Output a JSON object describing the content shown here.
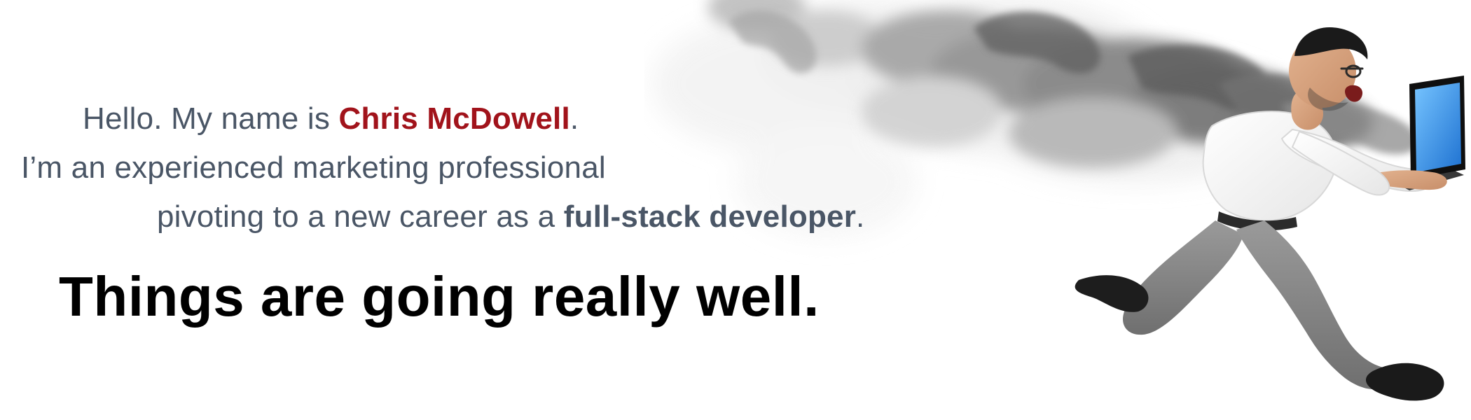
{
  "hero": {
    "intro": {
      "line1_prefix": "Hello. My name is ",
      "name": "Chris McDowell",
      "line1_suffix": ".",
      "line2": "I’m an experienced marketing professional",
      "line3_prefix": "pivoting to a new career as a ",
      "role": "full-stack developer",
      "line3_suffix": "."
    },
    "tagline": "Things are going really well."
  },
  "illustration": {
    "subject_icon": "running-man-with-laptop-icon",
    "smoke_icon": "smoke-trail-icon",
    "colors": {
      "name_accent": "#a1131b",
      "text_gray": "#4a5666",
      "tagline": "#000000",
      "laptop_screen": "#2f8ff0",
      "pants": "#8a8a8a",
      "shirt": "#f7f7f7",
      "smoke": "#5b5b5b"
    }
  }
}
